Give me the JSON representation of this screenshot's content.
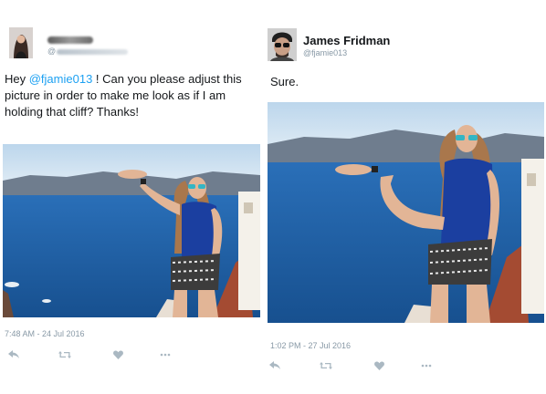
{
  "left_tweet": {
    "handle_prefix": "@",
    "text_intro": "Hey ",
    "mention": "@fjamie013",
    "text_body": " ! Can you please adjust this picture in order to make me look as if I am holding that cliff? Thanks!",
    "timestamp": "7:48 AM - 24 Jul 2016",
    "avatar_icon": "user-photo-avatar"
  },
  "right_tweet": {
    "name": "James Fridman",
    "handle": "@fjamie013",
    "text": "Sure.",
    "timestamp": "1:02 PM - 27 Jul 2016",
    "avatar_icon": "user-photo-avatar"
  },
  "actions": {
    "reply_icon": "reply-icon",
    "retweet_icon": "retweet-icon",
    "like_icon": "heart-icon",
    "more_icon": "more-icon"
  },
  "colors": {
    "text": "#14171a",
    "mention": "#1da1f2",
    "meta": "#8899a6",
    "action_icons": "#aab8c2",
    "sea": "#1f5fa8",
    "sky": "#c9dff0",
    "top": "#1b3fa0"
  }
}
